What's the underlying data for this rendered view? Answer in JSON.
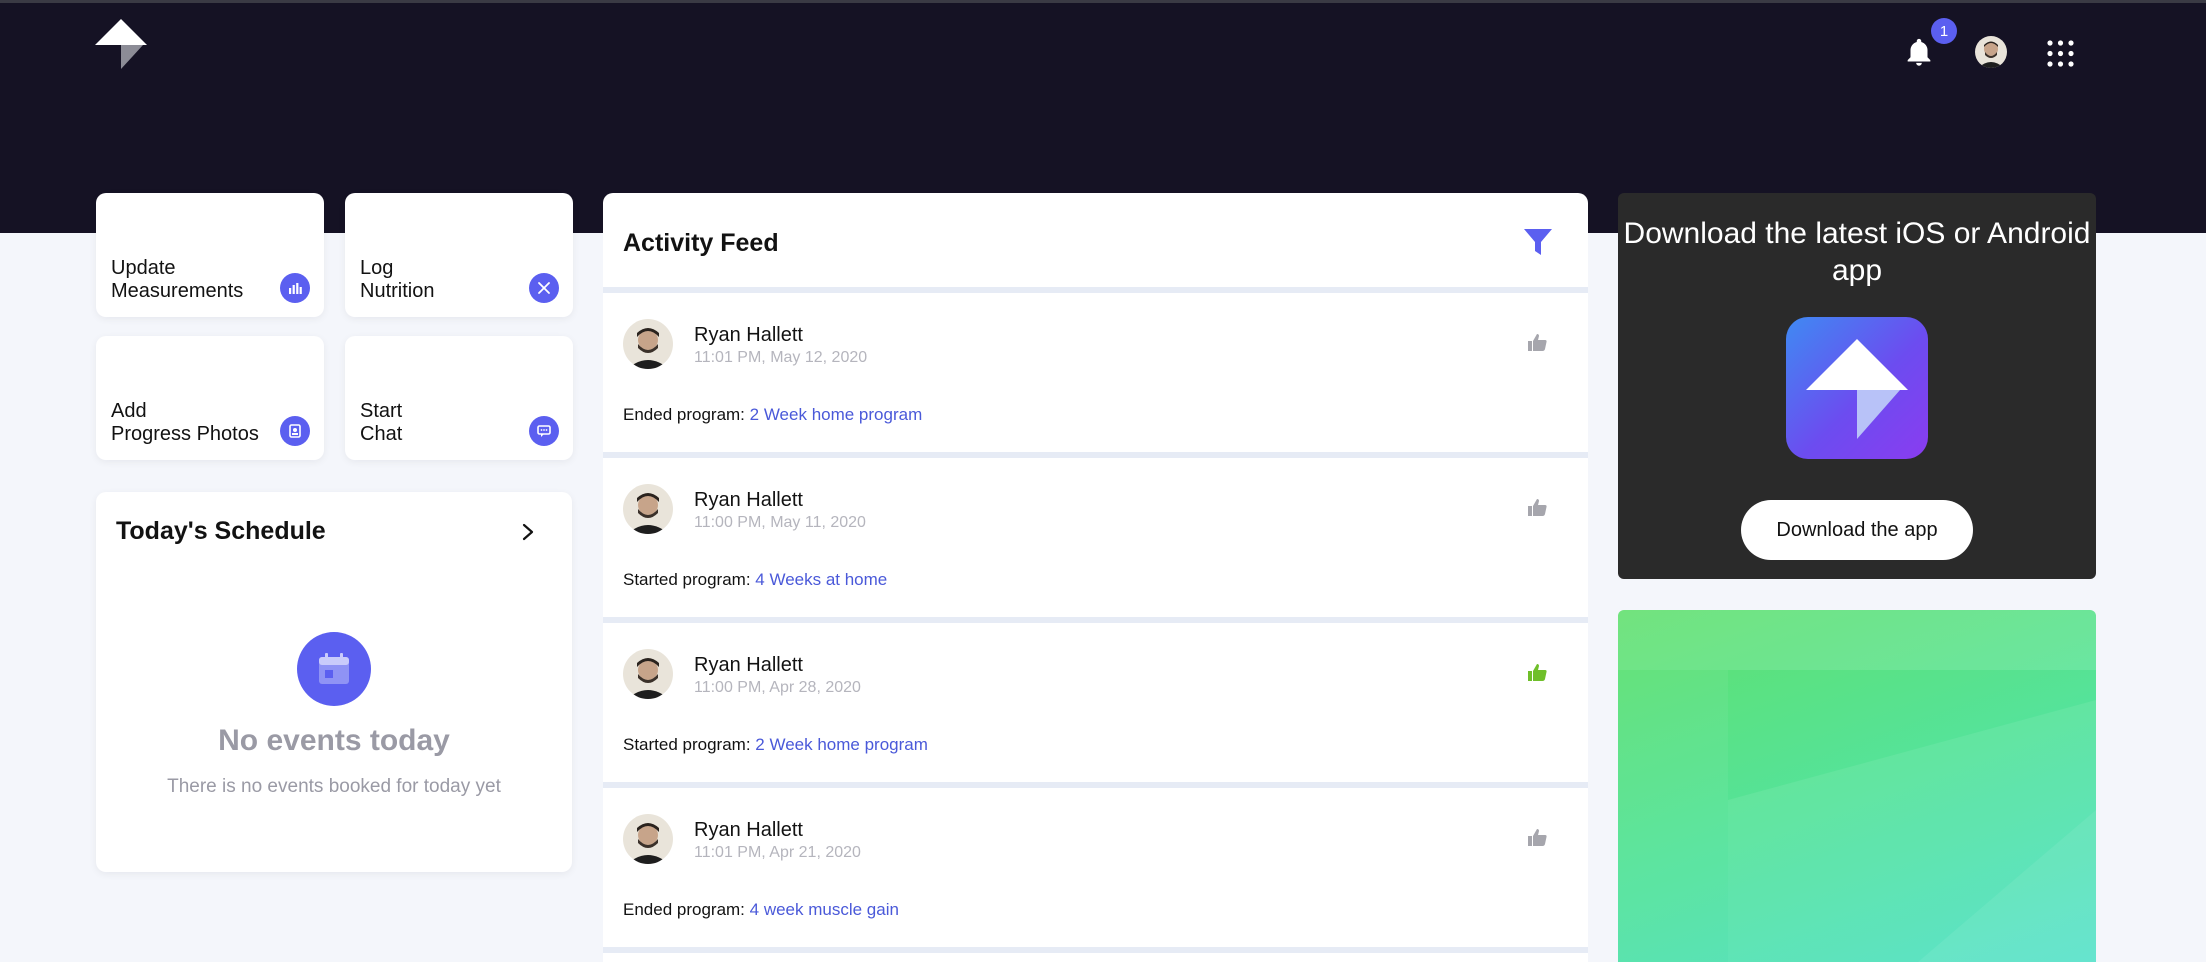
{
  "header": {
    "notification_count": "1",
    "colors": {
      "bar": "#151224",
      "accent": "#5b5ff0"
    },
    "icons": [
      "brand-logo-icon",
      "bell-icon",
      "user-avatar",
      "apps-grid-icon"
    ]
  },
  "tiles": [
    {
      "label": "Update\nMeasurements",
      "icon": "bar-chart-icon"
    },
    {
      "label": "Log\nNutrition",
      "icon": "utensils-icon"
    },
    {
      "label": "Add\nProgress Photos",
      "icon": "photo-icon"
    },
    {
      "label": "Start\nChat",
      "icon": "chat-icon"
    }
  ],
  "schedule": {
    "title": "Today's Schedule",
    "empty_title": "No events today",
    "empty_subtitle": "There is no events booked for today yet"
  },
  "feed": {
    "title": "Activity Feed",
    "items": [
      {
        "name": "Ryan Hallett",
        "time": "11:01 PM, May 12, 2020",
        "action": "Ended program: ",
        "program": "2 Week home program",
        "liked": false
      },
      {
        "name": "Ryan Hallett",
        "time": "11:00 PM, May 11, 2020",
        "action": "Started program: ",
        "program": "4 Weeks at home",
        "liked": false
      },
      {
        "name": "Ryan Hallett",
        "time": "11:00 PM, Apr 28, 2020",
        "action": "Started program: ",
        "program": "2 Week home program",
        "liked": true
      },
      {
        "name": "Ryan Hallett",
        "time": "11:01 PM, Apr 21, 2020",
        "action": "Ended program: ",
        "program": "4 week muscle gain",
        "liked": false
      }
    ]
  },
  "promo": {
    "title": "Download the latest iOS or Android app",
    "button": "Download the app"
  }
}
